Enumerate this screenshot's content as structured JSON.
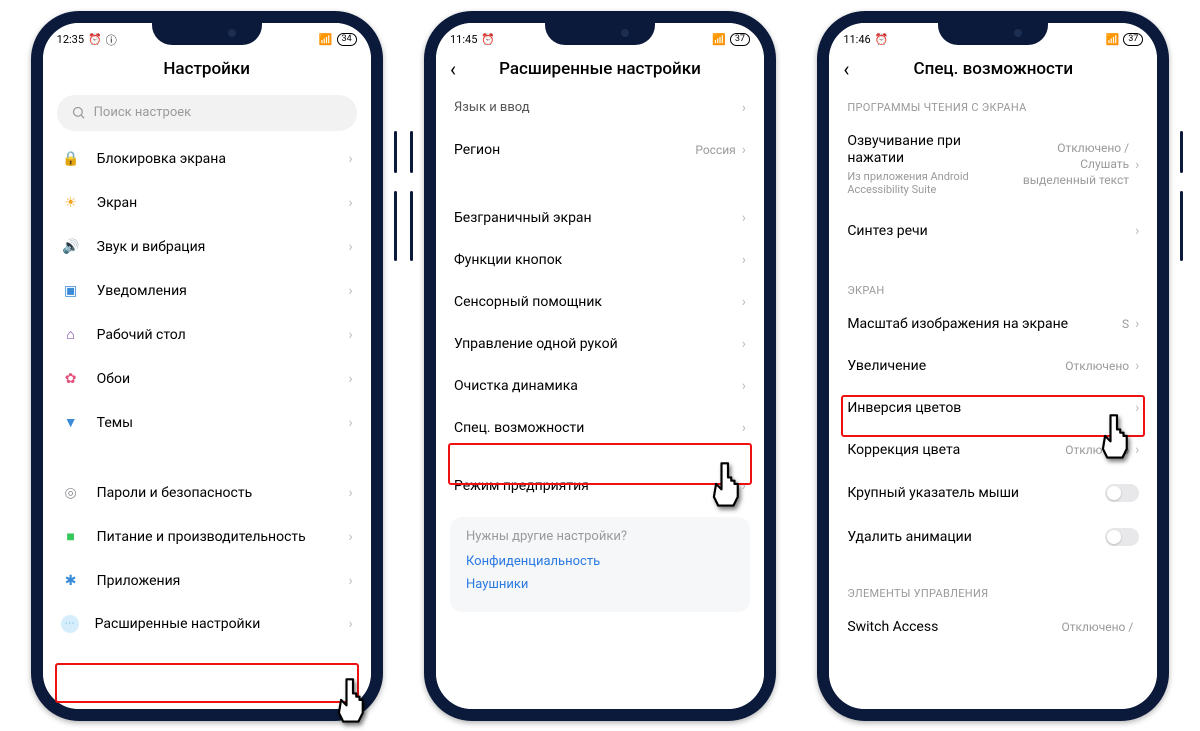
{
  "phones": [
    {
      "status": {
        "time": "12:35",
        "alarm": "⏰",
        "info": "ⓘ",
        "battery": "34"
      },
      "header": {
        "title": "Настройки",
        "back": false
      },
      "search_placeholder": "Поиск настроек",
      "rows": [
        {
          "icon": "🔒",
          "color": "#e05a3c",
          "label": "Блокировка экрана"
        },
        {
          "icon": "☀",
          "color": "#f5a623",
          "label": "Экран"
        },
        {
          "icon": "🔊",
          "color": "#34c759",
          "label": "Звук и вибрация"
        },
        {
          "icon": "▣",
          "color": "#3a8bd8",
          "label": "Уведомления"
        },
        {
          "icon": "⌂",
          "color": "#6b3fa0",
          "label": "Рабочий стол"
        },
        {
          "icon": "✿",
          "color": "#e2527a",
          "label": "Обои"
        },
        {
          "icon": "▼",
          "color": "#3a8bd8",
          "label": "Темы"
        }
      ],
      "rows2": [
        {
          "icon": "◎",
          "color": "#8e8e93",
          "label": "Пароли и безопасность"
        },
        {
          "icon": "■",
          "color": "#34c759",
          "label": "Питание и производительность"
        },
        {
          "icon": "✱",
          "color": "#3a8bd8",
          "label": "Приложения"
        },
        {
          "icon": "⋯",
          "color": "#5fb3e6",
          "label": "Расширенные настройки"
        }
      ],
      "highlight_index": 3
    },
    {
      "status": {
        "time": "11:45",
        "alarm": "⏰",
        "info": "",
        "battery": "37"
      },
      "header": {
        "title": "Расширенные настройки",
        "back": true
      },
      "rows": [
        {
          "label": "Язык и ввод",
          "truncated": true
        },
        {
          "label": "Регион",
          "value": "Россия"
        }
      ],
      "rows2": [
        {
          "label": "Безграничный экран"
        },
        {
          "label": "Функции кнопок"
        },
        {
          "label": "Сенсорный помощник"
        },
        {
          "label": "Управление одной рукой"
        },
        {
          "label": "Очистка динамика"
        },
        {
          "label": "Спец. возможности"
        }
      ],
      "rows3": [
        {
          "label": "Режим предприятия"
        }
      ],
      "panel": {
        "question": "Нужны другие настройки?",
        "links": [
          "Конфиденциальность",
          "Наушники"
        ]
      },
      "highlight_index": 5
    },
    {
      "status": {
        "time": "11:46",
        "alarm": "⏰",
        "info": "",
        "battery": "37"
      },
      "header": {
        "title": "Спец. возможности",
        "back": true
      },
      "section1_title": "ПРОГРАММЫ ЧТЕНИЯ С ЭКРАНА",
      "section1": [
        {
          "label": "Озвучивание при нажатии",
          "sub": "Из приложения Android Accessibility Suite",
          "value": "Отключено / Слушать выделенный текст"
        },
        {
          "label": "Синтез речи"
        }
      ],
      "section2_title": "ЭКРАН",
      "section2": [
        {
          "label": "Масштаб изображения на экране",
          "value": "S"
        },
        {
          "label": "Увеличение",
          "value": "Отключено"
        },
        {
          "label": "Инверсия цветов"
        },
        {
          "label": "Коррекция цвета",
          "value": "Отключено"
        },
        {
          "label": "Крупный указатель мыши",
          "toggle": true
        },
        {
          "label": "Удалить анимации",
          "toggle": true
        }
      ],
      "section3_title": "ЭЛЕМЕНТЫ УПРАВЛЕНИЯ",
      "section3": [
        {
          "label": "Switch Access",
          "value": "Отключено /"
        }
      ],
      "highlight_index": 1
    }
  ]
}
